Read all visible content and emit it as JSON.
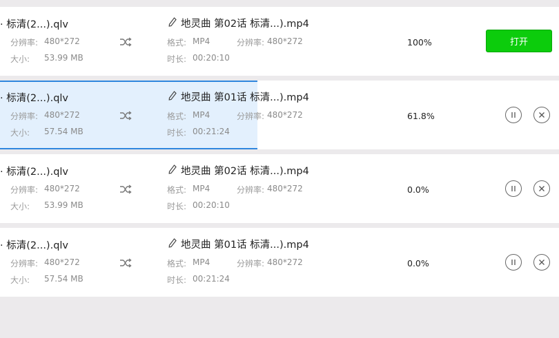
{
  "labels": {
    "resolution": "分辨率:",
    "size": "大小:",
    "format": "格式:",
    "duration": "时长:",
    "open": "打开"
  },
  "rows": [
    {
      "source_name": "· 标清(2...).qlv",
      "source_resolution": "480*272",
      "source_size": "53.99 MB",
      "target_name": "地灵曲 第02话 标清...).mp4",
      "target_format": "MP4",
      "target_resolution": "480*272",
      "target_duration": "00:20:10",
      "progress_text": "100%",
      "progress_fraction": 1.0,
      "state": "done"
    },
    {
      "source_name": "· 标清(2...).qlv",
      "source_resolution": "480*272",
      "source_size": "57.54 MB",
      "target_name": "地灵曲 第01话 标清...).mp4",
      "target_format": "MP4",
      "target_resolution": "480*272",
      "target_duration": "00:21:24",
      "progress_text": "61.8%",
      "progress_fraction": 0.618,
      "state": "converting"
    },
    {
      "source_name": "· 标清(2...).qlv",
      "source_resolution": "480*272",
      "source_size": "53.99 MB",
      "target_name": "地灵曲 第02话 标清...).mp4",
      "target_format": "MP4",
      "target_resolution": "480*272",
      "target_duration": "00:20:10",
      "progress_text": "0.0%",
      "progress_fraction": 0.0,
      "state": "queued"
    },
    {
      "source_name": "· 标清(2...).qlv",
      "source_resolution": "480*272",
      "source_size": "57.54 MB",
      "target_name": "地灵曲 第01话 标清...).mp4",
      "target_format": "MP4",
      "target_resolution": "480*272",
      "target_duration": "00:21:24",
      "progress_text": "0.0%",
      "progress_fraction": 0.0,
      "state": "queued"
    }
  ],
  "colors": {
    "accent_blue": "#2e86de",
    "progress_fill": "#e3f0fd",
    "open_button_green": "#0ccc0c"
  }
}
